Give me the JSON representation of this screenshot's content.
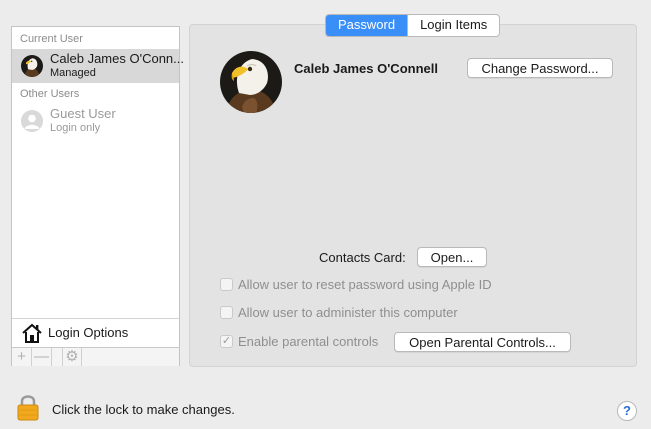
{
  "sidebar": {
    "current_user_header": "Current User",
    "current_user": {
      "name": "Caleb James O'Conn...",
      "role": "Managed"
    },
    "other_users_header": "Other Users",
    "other_users": [
      {
        "name": "Guest User",
        "role": "Login only"
      }
    ],
    "login_options_label": "Login Options",
    "add_symbol": "+",
    "remove_symbol": "—",
    "gear_symbol": "⚙"
  },
  "tabs": [
    {
      "label": "Password",
      "active": true
    },
    {
      "label": "Login Items",
      "active": false
    }
  ],
  "profile": {
    "full_name": "Caleb James O'Connell",
    "change_password_label": "Change Password..."
  },
  "contacts": {
    "label": "Contacts Card:",
    "open_label": "Open..."
  },
  "options": {
    "reset_password_label": "Allow user to reset password using Apple ID",
    "administer_label": "Allow user to administer this computer",
    "parental_controls_label": "Enable parental controls",
    "parental_controls_checked": true,
    "open_parental_label": "Open Parental Controls..."
  },
  "footer": {
    "lock_text": "Click the lock to make changes.",
    "help_symbol": "?"
  },
  "colors": {
    "accent": "#3a8ef8",
    "lock": "#f2a81c"
  }
}
